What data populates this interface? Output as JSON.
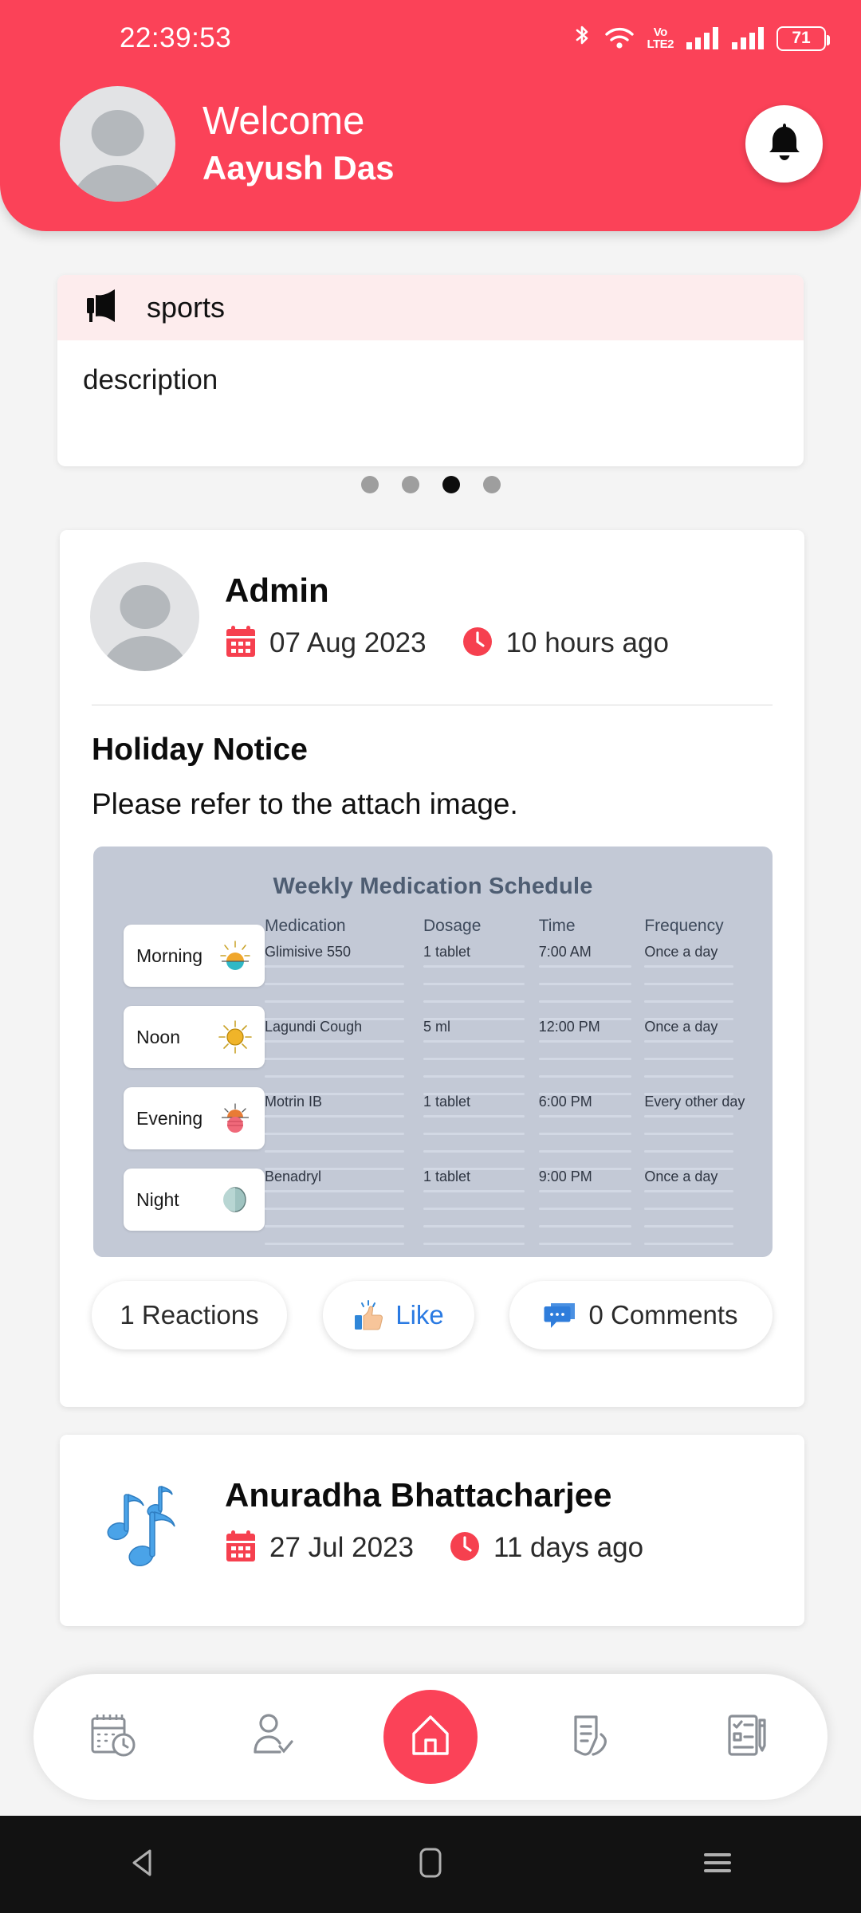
{
  "statusbar": {
    "time": "22:39:53",
    "battery_level": "71",
    "icons": [
      "bluetooth-icon",
      "wifi-icon",
      "volte-icon",
      "signal-1-icon",
      "signal-2-icon",
      "battery-icon"
    ],
    "volte_line1": "Vo",
    "volte_line2": "LTE",
    "volte_sim": "2"
  },
  "header": {
    "welcome_label": "Welcome",
    "user_name": "Aayush Das",
    "bell_icon": "bell-icon",
    "background_color": "#fb4258"
  },
  "announcement": {
    "icon": "megaphone-icon",
    "title": "sports",
    "description": "description",
    "header_color": "#fdeced"
  },
  "carousel": {
    "total": 4,
    "active_index": 2
  },
  "posts": [
    {
      "author": "Admin",
      "avatar": "user-avatar",
      "date": "07 Aug 2023",
      "relative_time": "10 hours ago",
      "title": "Holiday Notice",
      "body": "Please refer to the attach image.",
      "reactions_label": "1 Reactions",
      "like_label": "Like",
      "comments_label": "0 Comments"
    },
    {
      "author": "Anuradha Bhattacharjee",
      "avatar": "music-notes-icon",
      "date": "27 Jul 2023",
      "relative_time": "11 days ago"
    }
  ],
  "medication_image": {
    "title": "Weekly Medication Schedule",
    "columns": [
      "Medication",
      "Dosage",
      "Time",
      "Frequency"
    ],
    "slots": [
      {
        "label": "Morning",
        "icon": "sunrise-icon"
      },
      {
        "label": "Noon",
        "icon": "sun-icon"
      },
      {
        "label": "Evening",
        "icon": "sunset-icon"
      },
      {
        "label": "Night",
        "icon": "moon-icon"
      }
    ],
    "rows": [
      {
        "medication": "Glimisive 550",
        "dosage": "1 tablet",
        "time": "7:00 AM",
        "frequency": "Once a day"
      },
      {
        "medication": "Lagundi Cough",
        "dosage": "5 ml",
        "time": "12:00 PM",
        "frequency": "Once a day"
      },
      {
        "medication": "Motrin IB",
        "dosage": "1 tablet",
        "time": "6:00 PM",
        "frequency": "Every other day"
      },
      {
        "medication": "Benadryl",
        "dosage": "1 tablet",
        "time": "9:00 PM",
        "frequency": "Once a day"
      }
    ],
    "background_color": "#c3c9d6"
  },
  "bottom_nav": {
    "items": [
      {
        "icon": "calendar-clock-icon",
        "active": false
      },
      {
        "icon": "person-check-icon",
        "active": false
      },
      {
        "icon": "home-icon",
        "active": true
      },
      {
        "icon": "note-edit-icon",
        "active": false
      },
      {
        "icon": "checklist-pen-icon",
        "active": false
      }
    ],
    "active_color": "#fb4258"
  },
  "android_nav": {
    "back_icon": "back-triangle-icon",
    "home_icon": "home-square-icon",
    "recents_icon": "recents-lines-icon"
  }
}
